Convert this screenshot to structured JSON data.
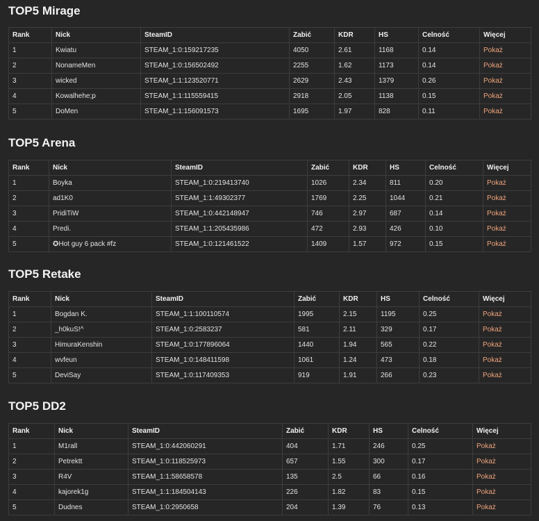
{
  "sections": [
    {
      "title": "TOP5 Mirage",
      "headers": [
        "Rank",
        "Nick",
        "SteamID",
        "Zabić",
        "KDR",
        "HS",
        "Celność",
        "Więcej"
      ],
      "rows": [
        [
          "1",
          "Kwiatu",
          "STEAM_1:0:159217235",
          "4050",
          "2.61",
          "1168",
          "0.14",
          "Pokaż"
        ],
        [
          "2",
          "NonameMen",
          "STEAM_1:0:156502492",
          "2255",
          "1.62",
          "1173",
          "0.14",
          "Pokaż"
        ],
        [
          "3",
          "wicked",
          "STEAM_1:1:123520771",
          "2629",
          "2.43",
          "1379",
          "0.26",
          "Pokaż"
        ],
        [
          "4",
          "Kowalhehe;p",
          "STEAM_1:1:115559415",
          "2918",
          "2.05",
          "1138",
          "0.15",
          "Pokaż"
        ],
        [
          "5",
          "DoMen",
          "STEAM_1:1:156091573",
          "1695",
          "1.97",
          "828",
          "0.11",
          "Pokaż"
        ]
      ]
    },
    {
      "title": "TOP5 Arena",
      "headers": [
        "Rank",
        "Nick",
        "SteamID",
        "Zabić",
        "KDR",
        "HS",
        "Celność",
        "Więcej"
      ],
      "rows": [
        [
          "1",
          "Boyka",
          "STEAM_1:0:219413740",
          "1026",
          "2.34",
          "811",
          "0.20",
          "Pokaż"
        ],
        [
          "2",
          "ad1K0",
          "STEAM_1:1:49302377",
          "1769",
          "2.25",
          "1044",
          "0.21",
          "Pokaż"
        ],
        [
          "3",
          "PridiTiW",
          "STEAM_1:0:442148947",
          "746",
          "2.97",
          "687",
          "0.14",
          "Pokaż"
        ],
        [
          "4",
          "Predi.",
          "STEAM_1:1:205435986",
          "472",
          "2.93",
          "426",
          "0.10",
          "Pokaż"
        ],
        [
          "5",
          "✪Hot guy 6 pack #fz",
          "STEAM_1:0:121461522",
          "1409",
          "1.57",
          "972",
          "0.15",
          "Pokaż"
        ]
      ]
    },
    {
      "title": "TOP5 Retake",
      "headers": [
        "Rank",
        "Nick",
        "SteamID",
        "Zabić",
        "KDR",
        "HS",
        "Celność",
        "Więcej"
      ],
      "rows": [
        [
          "1",
          "Bogdan K.",
          "STEAM_1:1:100110574",
          "1995",
          "2.15",
          "1195",
          "0.25",
          "Pokaż"
        ],
        [
          "2",
          "_h0kuS!^",
          "STEAM_1:0:2583237",
          "581",
          "2.11",
          "329",
          "0.17",
          "Pokaż"
        ],
        [
          "3",
          "HimuraKenshin",
          "STEAM_1:0:177896064",
          "1440",
          "1.94",
          "565",
          "0.22",
          "Pokaż"
        ],
        [
          "4",
          "wvfeun",
          "STEAM_1:0:148411598",
          "1061",
          "1.24",
          "473",
          "0.18",
          "Pokaż"
        ],
        [
          "5",
          "DeviSay",
          "STEAM_1:0:117409353",
          "919",
          "1.91",
          "266",
          "0.23",
          "Pokaż"
        ]
      ]
    },
    {
      "title": "TOP5 DD2",
      "headers": [
        "Rank",
        "Nick",
        "SteamID",
        "Zabić",
        "KDR",
        "HS",
        "Celność",
        "Więcej"
      ],
      "rows": [
        [
          "1",
          "M1rall",
          "STEAM_1:0:442060291",
          "404",
          "1.71",
          "246",
          "0.25",
          "Pokaż"
        ],
        [
          "2",
          "Petrektt",
          "STEAM_1:0:118525973",
          "657",
          "1.55",
          "300",
          "0.17",
          "Pokaż"
        ],
        [
          "3",
          "R4V",
          "STEAM_1:1:58658578",
          "135",
          "2.5",
          "66",
          "0.16",
          "Pokaż"
        ],
        [
          "4",
          "kajorek1g",
          "STEAM_1:1:184504143",
          "226",
          "1.82",
          "83",
          "0.15",
          "Pokaż"
        ],
        [
          "5",
          "Dudnes",
          "STEAM_1:0:2950658",
          "204",
          "1.39",
          "76",
          "0.13",
          "Pokaż"
        ]
      ]
    }
  ]
}
